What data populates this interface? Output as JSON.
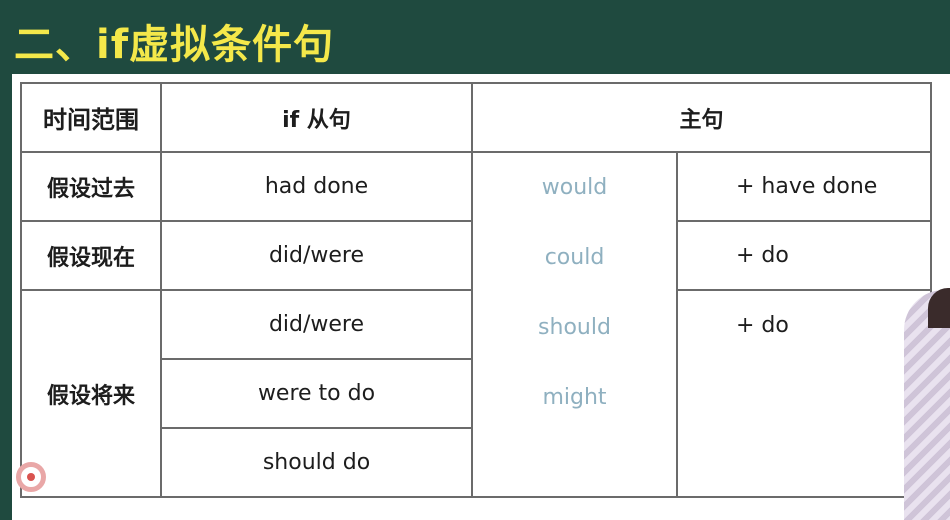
{
  "title": "二、if虚拟条件句",
  "header": {
    "time_range": "时间范围",
    "if_clause": "if 从句",
    "main_clause": "主句"
  },
  "rows": {
    "past": {
      "label": "假设过去",
      "if_clause": "had done",
      "main": "+ have done"
    },
    "present": {
      "label": "假设现在",
      "if_clause": "did/were",
      "main": "+ do"
    },
    "future": {
      "label": "假设将来",
      "if_clauses": [
        "did/were",
        "were to do",
        "should do"
      ],
      "main": "+ do"
    }
  },
  "modals": [
    "would",
    "could",
    "should",
    "might"
  ],
  "colors": {
    "background": "#1f4a3f",
    "title": "#f4e84a",
    "label": "#b0103f",
    "modal": "#8fb0c0"
  }
}
